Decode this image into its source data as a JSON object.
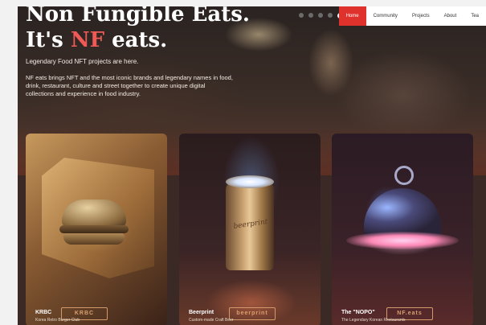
{
  "header": {
    "title_line1": "Non Fungible Eats.",
    "title_line2_prefix": "It's ",
    "title_line2_accent": "NF",
    "title_line2_suffix": " eats.",
    "tagline": "Legendary Food NFT projects are here.",
    "description": "NF eats brings NFT and the most iconic brands and legendary names in food, drink, restaurant, culture and street together to create unique digital collections and experience in food industry."
  },
  "nav": {
    "items": [
      {
        "label": "Home",
        "active": true
      },
      {
        "label": "Community",
        "active": false
      },
      {
        "label": "Projects",
        "active": false
      },
      {
        "label": "About",
        "active": false
      },
      {
        "label": "Tea",
        "active": false
      }
    ]
  },
  "socials": [
    "discord-icon",
    "twitter-icon",
    "youtube-icon",
    "instagram-icon"
  ],
  "cards": [
    {
      "name": "KRBC",
      "subtitle": "Korea Retro Burger Club",
      "sign": "KRBC"
    },
    {
      "name": "Beerprint",
      "subtitle": "Custom-made Craft Beer",
      "sign": "beerprint",
      "can_label": "beerprint"
    },
    {
      "name": "The \"NOPO\"",
      "subtitle": "The Legendary Korean Restaurants",
      "sign": "NF.eats"
    }
  ],
  "colors": {
    "accent": "#e0322c",
    "title_accent": "#ef5a57"
  }
}
